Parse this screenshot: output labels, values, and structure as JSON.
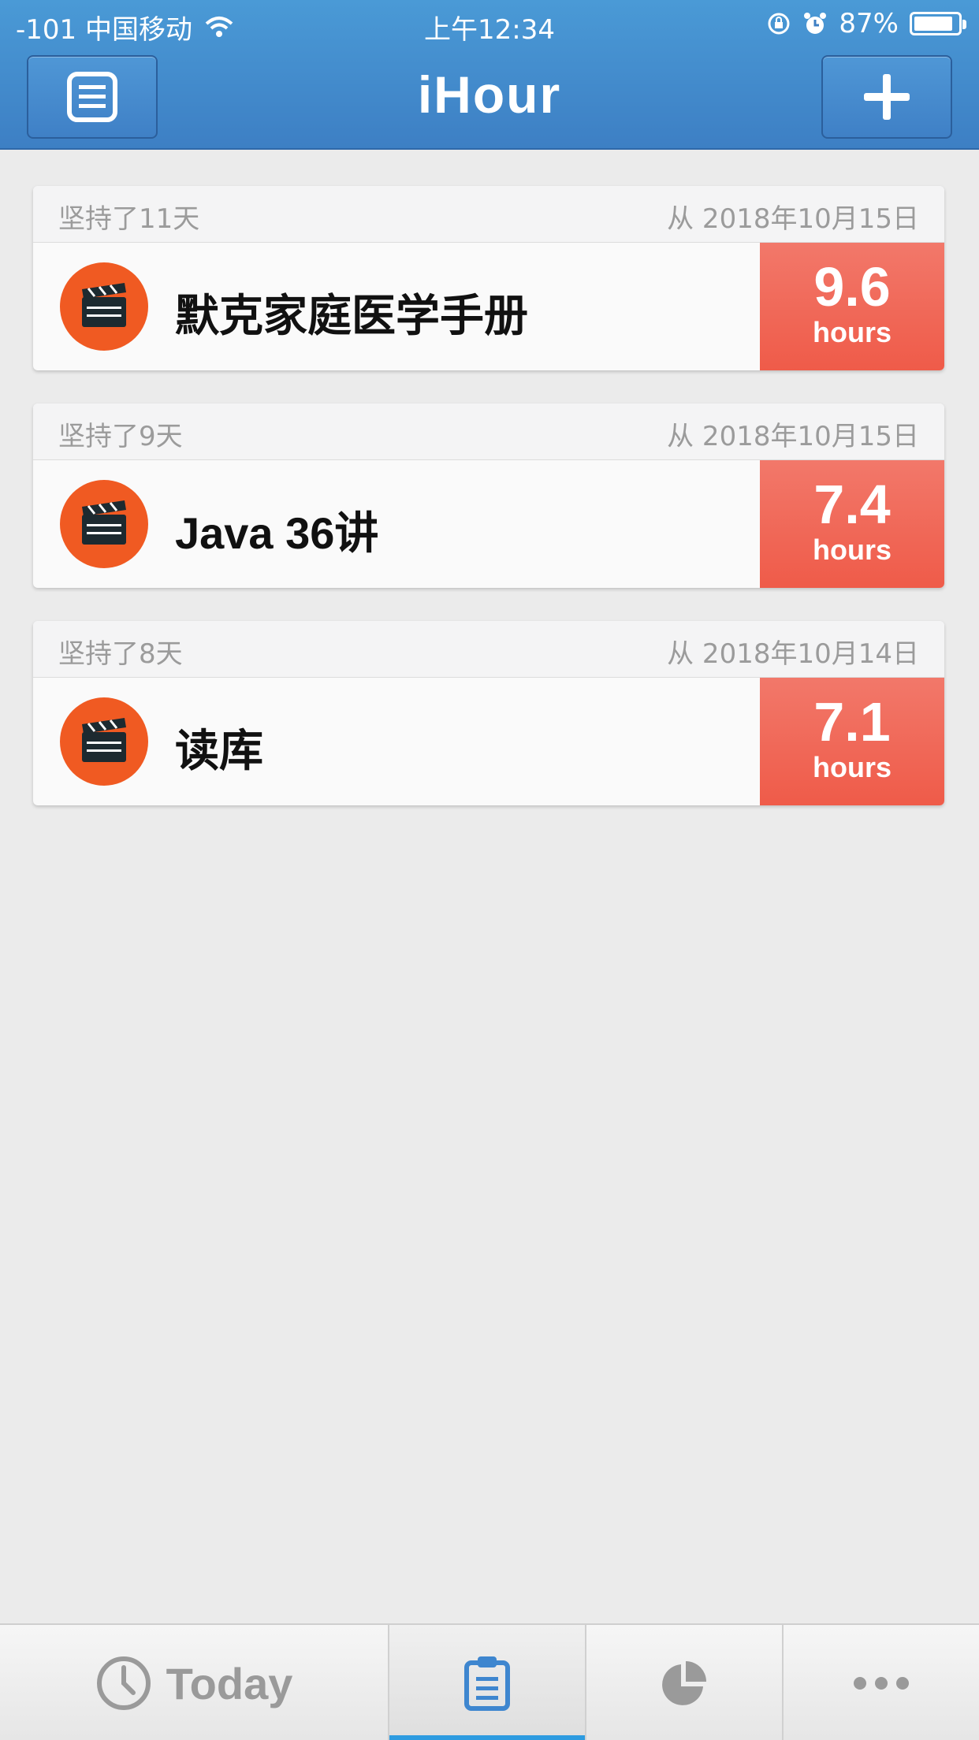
{
  "status_bar": {
    "carrier": "-101 中国移动",
    "time": "上午12:34",
    "battery": "87%"
  },
  "nav": {
    "title": "iHour"
  },
  "tasks": [
    {
      "streak": "坚持了11天",
      "since": "从 2018年10月15日",
      "name": "默克家庭医学手册",
      "hours": "9.6",
      "unit": "hours"
    },
    {
      "streak": "坚持了9天",
      "since": "从 2018年10月15日",
      "name": "Java 36讲",
      "hours": "7.4",
      "unit": "hours"
    },
    {
      "streak": "坚持了8天",
      "since": "从 2018年10月14日",
      "name": "读库",
      "hours": "7.1",
      "unit": "hours"
    }
  ],
  "tabbar": {
    "today_label": "Today",
    "active_tab": "list"
  },
  "colors": {
    "header_blue": "#3d7fc4",
    "hours_red": "#ef5b49",
    "icon_orange": "#f05a22",
    "active_tab": "#2d9be0"
  },
  "icons": {
    "menu": "list-icon",
    "add": "plus-icon",
    "task": "clapperboard-icon",
    "today": "clock-icon",
    "list": "clipboard-icon",
    "stats": "pie-chart-icon",
    "more": "ellipsis-icon"
  }
}
